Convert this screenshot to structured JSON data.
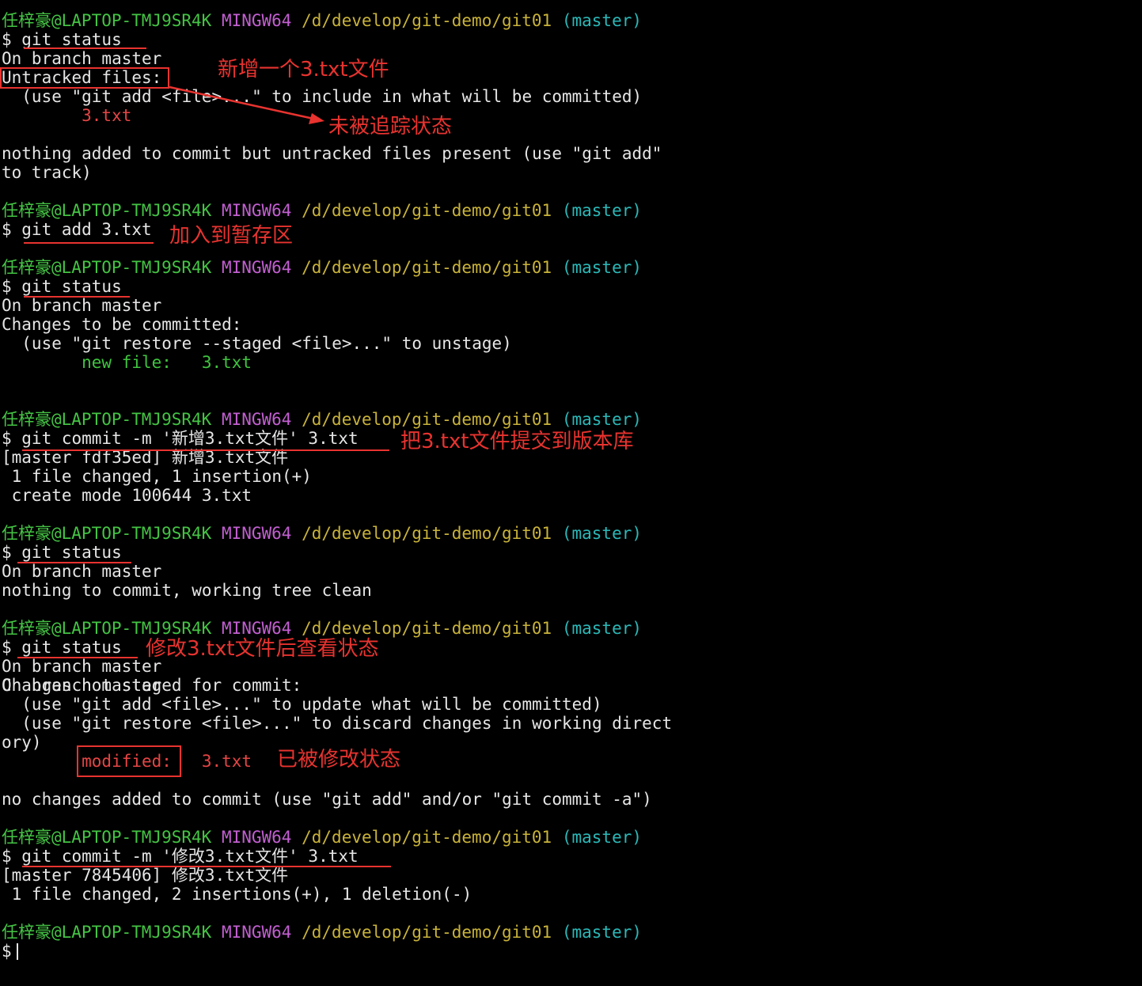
{
  "terminal": {
    "prompt": {
      "user": "任梓豪",
      "host": "@LAPTOP-TMJ9SR4K",
      "system": "MINGW64",
      "path": "/d/develop/git-demo/git01",
      "branch": "(master)",
      "symbol": "$"
    },
    "lines": [
      {
        "text": "$ git status"
      },
      {
        "text": "On branch master"
      },
      {
        "text": "Untracked files:"
      },
      {
        "text": "  (use \"git add <file>...\" to include in what will be committed)"
      },
      {
        "text": "        3.txt"
      },
      {
        "text": "nothing added to commit but untracked files present (use \"git add\""
      },
      {
        "text": "to track)"
      },
      {
        "text": "$ git add 3.txt"
      },
      {
        "text": "$ git status"
      },
      {
        "text": "On branch master"
      },
      {
        "text": "Changes to be committed:"
      },
      {
        "text": "  (use \"git restore --staged <file>...\" to unstage)"
      },
      {
        "text": "        new file:   3.txt"
      },
      {
        "text": "$ git commit -m '新增3.txt文件' 3.txt"
      },
      {
        "text": "[master fdf35ed] 新增3.txt文件"
      },
      {
        "text": " 1 file changed, 1 insertion(+)"
      },
      {
        "text": " create mode 100644 3.txt"
      },
      {
        "text": "$ git status"
      },
      {
        "text": "On branch master"
      },
      {
        "text": "nothing to commit, working tree clean"
      },
      {
        "text": "$ git status"
      },
      {
        "text": "On branch master"
      },
      {
        "text": "Changes not staged for commit:"
      },
      {
        "text": "  (use \"git add <file>...\" to update what will be committed)"
      },
      {
        "text": "  (use \"git restore <file>...\" to discard changes in working direct"
      },
      {
        "text": "ory)"
      },
      {
        "text": "        modified:   3.txt"
      },
      {
        "text": "no changes added to commit (use \"git add\" and/or \"git commit -a\")"
      },
      {
        "text": "$ git commit -m '修改3.txt文件' 3.txt"
      },
      {
        "text": "[master 7845406] 修改3.txt文件"
      },
      {
        "text": " 1 file changed, 2 insertions(+), 1 deletion(-)"
      },
      {
        "text": "$"
      }
    ]
  },
  "annotations": {
    "new_file": "新增一个3.txt文件",
    "untracked": "未被追踪状态",
    "staged": "加入到暂存区",
    "commit": "把3.txt文件提交到版本库",
    "after_modify": "修改3.txt文件后查看状态",
    "modified_state": "已被修改状态"
  },
  "colors": {
    "background": "#000000",
    "text": "#e6e6e6",
    "user": "#44c444",
    "system": "#c25fd1",
    "path": "#c9b33a",
    "branch": "#2bb8b8",
    "git_red": "#e64545",
    "git_green": "#3fc43f",
    "annotation_red": "#e8332f"
  }
}
